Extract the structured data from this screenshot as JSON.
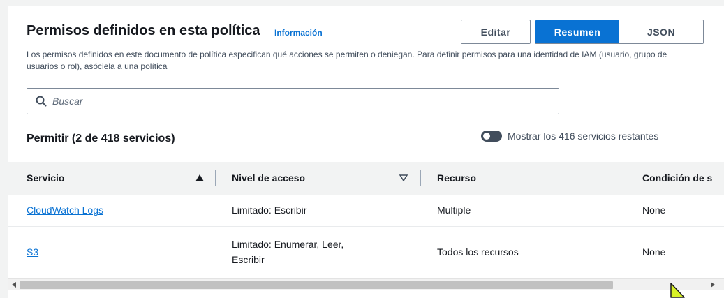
{
  "header": {
    "title": "Permisos definidos en esta política",
    "info_link": "Información",
    "description": "Los permisos definidos en este documento de política especifican qué acciones se permiten o deniegan. Para definir permisos para una identidad de IAM (usuario, grupo de usuarios o rol), asóciela a una política"
  },
  "actions": {
    "edit_label": "Editar",
    "view_modes": [
      {
        "label": "Resumen",
        "selected": true
      },
      {
        "label": "JSON",
        "selected": false
      }
    ]
  },
  "search": {
    "placeholder": "Buscar",
    "value": ""
  },
  "allow_section": {
    "title": "Permitir (2 de 418 servicios)",
    "toggle_label": "Mostrar los 416 servicios restantes",
    "toggle_on": false
  },
  "table": {
    "columns": [
      {
        "label": "Servicio",
        "sort": "ascending"
      },
      {
        "label": "Nivel de acceso",
        "sort": "none"
      },
      {
        "label": "Recurso"
      },
      {
        "label": "Condición de s"
      }
    ],
    "rows": [
      {
        "service": "CloudWatch Logs",
        "access_level": "Limitado: Escribir",
        "resource": "Multiple",
        "condition": "None"
      },
      {
        "service": "S3",
        "access_level_line1": "Limitado: Enumerar, Leer,",
        "access_level_line2": "Escribir",
        "resource": "Todos los recursos",
        "condition": "None"
      }
    ]
  },
  "colors": {
    "accent": "#0972d3",
    "cursor": "#d9f227"
  }
}
